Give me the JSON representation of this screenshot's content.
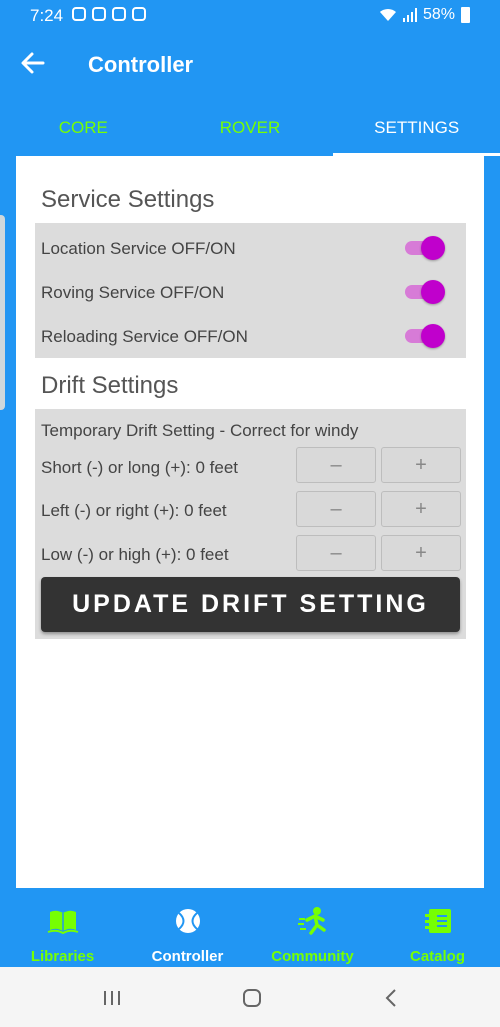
{
  "status_bar": {
    "time": "7:24",
    "battery": "58%"
  },
  "app_bar": {
    "title": "Controller"
  },
  "tabs": [
    {
      "label": "CORE"
    },
    {
      "label": "ROVER"
    },
    {
      "label": "SETTINGS"
    }
  ],
  "service_settings": {
    "title": "Service Settings",
    "items": [
      {
        "label": "Location Service OFF/ON",
        "on": true
      },
      {
        "label": "Roving Service OFF/ON",
        "on": true
      },
      {
        "label": "Reloading Service OFF/ON",
        "on": true
      }
    ]
  },
  "drift_settings": {
    "title": "Drift Settings",
    "subtitle": "Temporary Drift Setting - Correct for windy",
    "rows": [
      {
        "label": "Short (-) or long (+): 0 feet"
      },
      {
        "label": "Left (-) or right (+): 0 feet"
      },
      {
        "label": "Low (-) or high (+): 0 feet"
      }
    ],
    "minus_label": "–",
    "plus_label": "+",
    "update_label": "UPDATE DRIFT SETTING"
  },
  "bottom_nav": [
    {
      "label": "Libraries",
      "icon": "book-icon"
    },
    {
      "label": "Controller",
      "icon": "tennis-ball-icon"
    },
    {
      "label": "Community",
      "icon": "runner-icon"
    },
    {
      "label": "Catalog",
      "icon": "catalog-icon"
    }
  ],
  "colors": {
    "primary": "#2196f3",
    "accent_green": "#76ff03",
    "toggle_on": "#c000cc",
    "panel": "#dcdcdc",
    "button_dark": "#333333"
  }
}
